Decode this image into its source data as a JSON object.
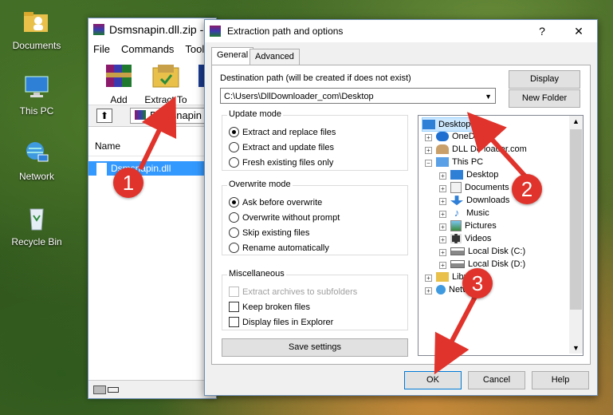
{
  "desktop": {
    "icons": [
      {
        "label": "Documents"
      },
      {
        "label": "This PC"
      },
      {
        "label": "Network"
      },
      {
        "label": "Recycle Bin"
      }
    ]
  },
  "winrar": {
    "title": "Dsmsnapin.dll.zip - ",
    "menu": [
      "File",
      "Commands",
      "Tools"
    ],
    "toolbar": {
      "add": "Add",
      "extract_to": "Extract To"
    },
    "address": "Dsmsnapin",
    "column_name": "Name",
    "file": "Dsmsnapin.dll"
  },
  "dialog": {
    "title": "Extraction path and options",
    "help_glyph": "?",
    "close_glyph": "✕",
    "tabs": [
      "General",
      "Advanced"
    ],
    "dest_label": "Destination path (will be created if does not exist)",
    "dest_value": "C:\\Users\\DllDownloader_com\\Desktop",
    "display_btn": "Display",
    "new_folder_btn": "New Folder",
    "update_mode": {
      "title": "Update mode",
      "options": [
        "Extract and replace files",
        "Extract and update files",
        "Fresh existing files only"
      ],
      "selected": 0
    },
    "overwrite_mode": {
      "title": "Overwrite mode",
      "options": [
        "Ask before overwrite",
        "Overwrite without prompt",
        "Skip existing files",
        "Rename automatically"
      ],
      "selected": 0
    },
    "misc": {
      "title": "Miscellaneous",
      "options": [
        "Extract archives to subfolders",
        "Keep broken files",
        "Display files in Explorer"
      ]
    },
    "save_settings": "Save settings",
    "tree": {
      "desktop": "Desktop",
      "onedrive": "OneD",
      "dlldownloader": "DLL Do    loader.com",
      "thispc": "This PC",
      "children": [
        "Desktop",
        "Documents",
        "Downloads",
        "Music",
        "Pictures",
        "Videos",
        "Local Disk (C:)",
        "Local Disk (D:)"
      ],
      "libraries": "Libr",
      "network": "Netw"
    },
    "ok": "OK",
    "cancel": "Cancel",
    "help": "Help"
  },
  "annotations": [
    "1",
    "2",
    "3"
  ],
  "colors": {
    "selection": "#3399ff",
    "badge": "#e0332b",
    "arrow": "#e0332b"
  }
}
